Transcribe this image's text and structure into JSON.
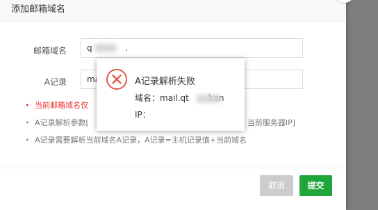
{
  "dialog": {
    "title": "添加邮箱域名",
    "fields": {
      "domain_label": "邮箱域名",
      "domain_value": "q",
      "domain_value_tail": ".",
      "a_record_label": "A记录",
      "a_record_value": "ma"
    },
    "tips": [
      "当前邮箱域名仅",
      "A记录解析参数[",
      "当前服务器IP]",
      "A记录需要解析当前域名A记录，A记录=主机记录值+当前域名"
    ],
    "buttons": {
      "cancel": "取消",
      "submit": "提交"
    }
  },
  "alert": {
    "title": "A记录解析失败",
    "domain_label": "域名：",
    "domain_value": "mail.qt",
    "domain_value_tail": "han",
    "ip_label": "IP："
  },
  "colors": {
    "accent": "#20a53a",
    "error": "#e33e33",
    "warning_text": "#ee3333"
  }
}
